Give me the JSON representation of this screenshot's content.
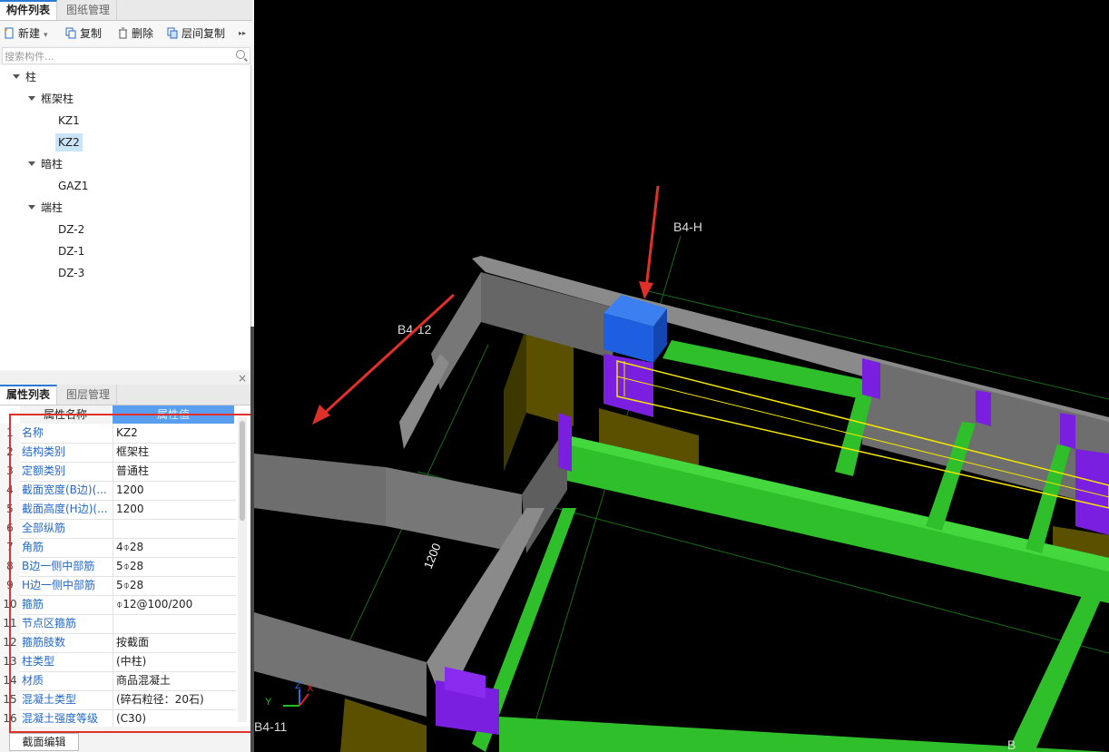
{
  "top_tabs": [
    "构件列表",
    "图纸管理"
  ],
  "toolbar": {
    "new": "新建",
    "copy": "复制",
    "delete": "删除",
    "floor_copy": "层间复制",
    "more": "▸▸"
  },
  "search": {
    "placeholder": "搜索构件..."
  },
  "tree": {
    "root": "柱",
    "groups": [
      {
        "label": "框架柱",
        "items": [
          "KZ1",
          "KZ2"
        ]
      },
      {
        "label": "暗柱",
        "items": [
          "GAZ1"
        ]
      },
      {
        "label": "端柱",
        "items": [
          "DZ-2",
          "DZ-1",
          "DZ-3"
        ]
      }
    ],
    "selected": "KZ2"
  },
  "bottom_tabs": [
    "属性列表",
    "图层管理"
  ],
  "close_label": "×",
  "grid": {
    "head_name": "属性名称",
    "head_value": "属性值",
    "rows": [
      {
        "n": "1",
        "k": "名称",
        "v": "KZ2"
      },
      {
        "n": "2",
        "k": "结构类别",
        "v": "框架柱"
      },
      {
        "n": "3",
        "k": "定额类别",
        "v": "普通柱"
      },
      {
        "n": "4",
        "k": "截面宽度(B边)(...",
        "v": "1200"
      },
      {
        "n": "5",
        "k": "截面高度(H边)(...",
        "v": "1200"
      },
      {
        "n": "6",
        "k": "全部纵筋",
        "v": ""
      },
      {
        "n": "7",
        "k": "角筋",
        "v": "4⌽28"
      },
      {
        "n": "8",
        "k": "B边一侧中部筋",
        "v": "5⌽28"
      },
      {
        "n": "9",
        "k": "H边一侧中部筋",
        "v": "5⌽28"
      },
      {
        "n": "10",
        "k": "箍筋",
        "v": "⌽12@100/200"
      },
      {
        "n": "11",
        "k": "节点区箍筋",
        "v": ""
      },
      {
        "n": "12",
        "k": "箍筋肢数",
        "v": "按截面"
      },
      {
        "n": "13",
        "k": "柱类型",
        "v": "(中柱)"
      },
      {
        "n": "14",
        "k": "材质",
        "v": "商品混凝土"
      },
      {
        "n": "15",
        "k": "混凝土类型",
        "v": "(碎石粒径：20石)"
      },
      {
        "n": "16",
        "k": "混凝土强度等级",
        "v": "(C30)"
      }
    ]
  },
  "bottom_button": "截面编辑",
  "view": {
    "labels": {
      "b4h": "B4-H",
      "b412": "B4-12",
      "b411": "B4-11",
      "dim": "1200",
      "b_edge": "B"
    },
    "axes": {
      "x": "X",
      "y": "Y",
      "z": "Z"
    },
    "colors": {
      "wall": "#7c7c7c",
      "beam": "#2fbf2a",
      "column": "#7a1fe0",
      "selected_column": "#1d5fe0",
      "footing": "#5a5000",
      "arrow": "#e0302a",
      "selection": "#f2e600"
    }
  }
}
